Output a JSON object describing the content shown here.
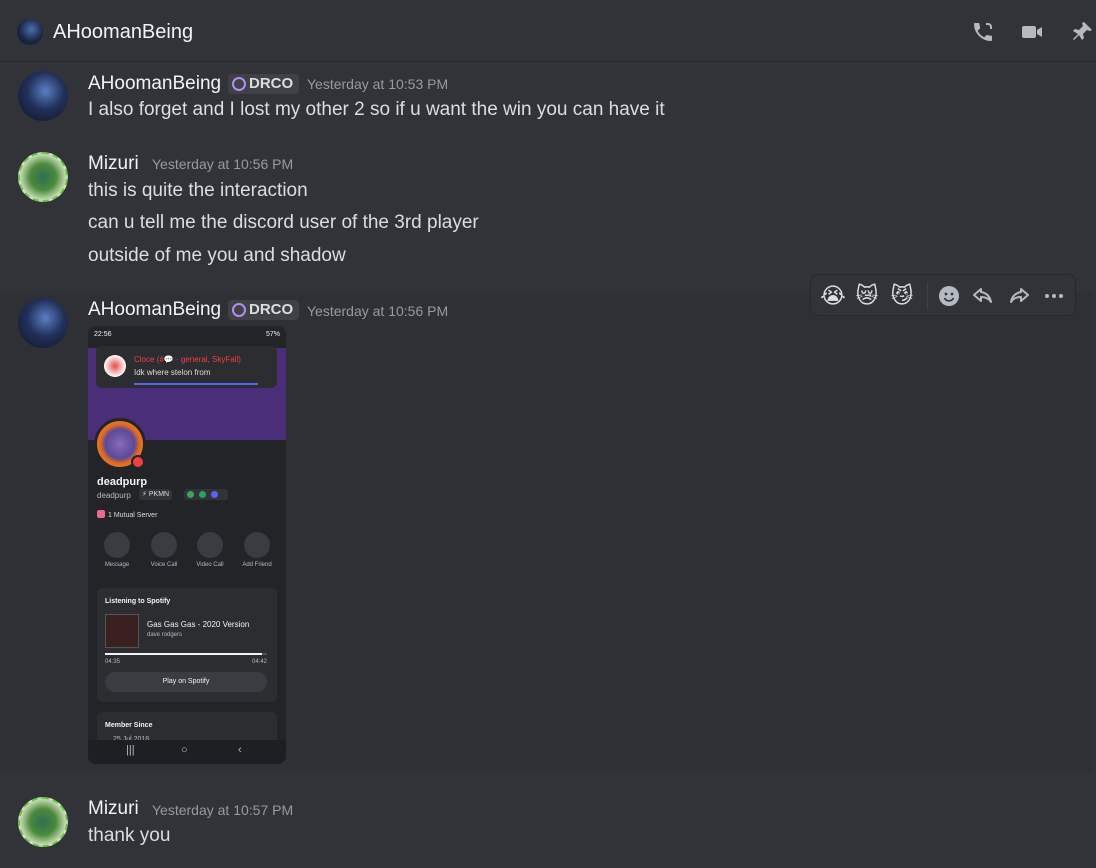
{
  "header": {
    "title": "AHoomanBeing",
    "icons": [
      "phone-call-icon",
      "video-call-icon",
      "pin-icon"
    ]
  },
  "messages": [
    {
      "author": "AHoomanBeing",
      "tag": "DRCO",
      "timestamp": "Yesterday at 10:53 PM",
      "lines": [
        "I also forget and I lost my other 2 so if u want the win you can have it"
      ]
    },
    {
      "author": "Mizuri",
      "timestamp": "Yesterday at 10:56 PM",
      "lines": [
        "this is quite the interaction",
        "can u tell me the discord user of the 3rd player",
        "outside of me you and shadow"
      ]
    },
    {
      "author": "AHoomanBeing",
      "tag": "DRCO",
      "timestamp": "Yesterday at 10:56 PM",
      "attachment": {
        "status_time": "22:56",
        "status_battery": "57%",
        "notification_title": "Cloce (#💬 · general, SkyFall)",
        "notification_body": "Idk where stelon from",
        "profile_name": "deadpurp",
        "profile_username": "deadpurp",
        "profile_tag": "⚡ PKMN",
        "mutual": "1 Mutual Server",
        "actions": [
          "Message",
          "Voice Call",
          "Video Call",
          "Add Friend"
        ],
        "spotify_label": "Listening to Spotify",
        "song": "Gas Gas Gas - 2020 Version",
        "artist": "dave rodgers",
        "time_elapsed": "04:35",
        "time_total": "04:42",
        "progress": 0.97,
        "play_label": "Play on Spotify",
        "member_since_label": "Member Since",
        "member_since_date": "25 Jul 2018"
      }
    },
    {
      "author": "Mizuri",
      "timestamp": "Yesterday at 10:57 PM",
      "lines": [
        "thank you"
      ]
    }
  ],
  "toolbar": {
    "reactions": [
      "😭",
      "😿",
      "😼"
    ],
    "actions": [
      "add-reaction-icon",
      "reply-icon",
      "forward-icon",
      "more-icon"
    ]
  }
}
